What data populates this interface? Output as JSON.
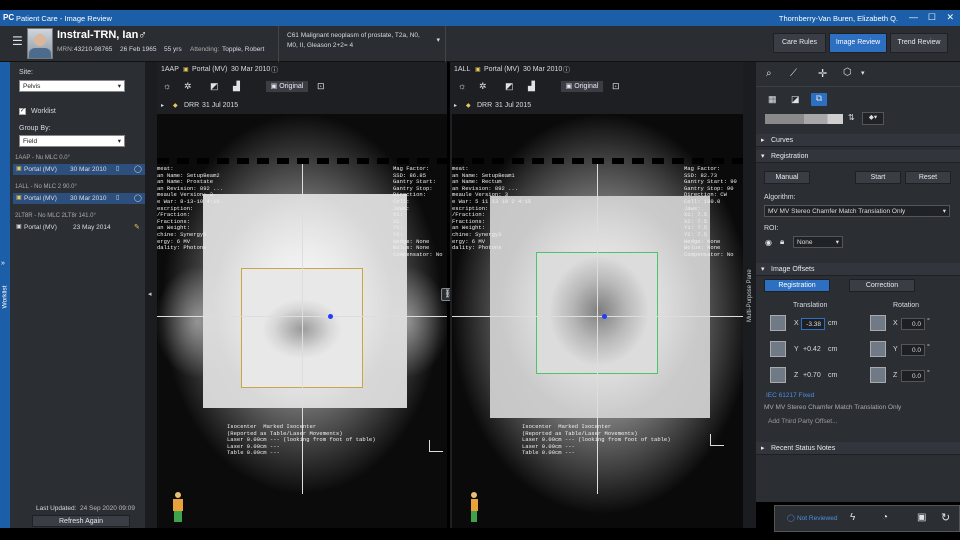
{
  "titlebar": {
    "logo": "PC",
    "title": "Patient Care - Image Review",
    "user": "Thornberry-Van Buren, Elizabeth Q.",
    "min": "—",
    "max": "☐",
    "close": "✕"
  },
  "patient": {
    "name": "Instral-TRN, Ian",
    "sex_symbol": "♂",
    "mrn_label": "MRN:",
    "mrn": "43210-98765",
    "dob": "26 Feb 1965",
    "age": "55 yrs",
    "attending_label": "Attending:",
    "attending": "Topple, Robert",
    "diagnosis_line1": "C61 Malignant neoplasm of prostate, T2a, N0,",
    "diagnosis_line2": "M0, II, Gleason 2+2= 4"
  },
  "nav_tabs": [
    "Care Rules",
    "Image Review",
    "Trend Review"
  ],
  "left": {
    "site_label": "Site:",
    "site_value": "Pelvis",
    "worklist_label": "Worklist",
    "groupby_label": "Group By:",
    "groupby_value": "Field",
    "groups": [
      {
        "header": "1AAP - Nu MLC 0.0°",
        "items": [
          {
            "label": "Portal (MV)",
            "date": "30 Mar 2010",
            "selected": true
          }
        ]
      },
      {
        "header": "1ALL - No MLC 2 90.0°",
        "items": [
          {
            "label": "Portal (MV)",
            "date": "30 Mar 2010",
            "selected": true
          }
        ]
      },
      {
        "header": "2LT8R - No MLC 2LT8r 141.0°",
        "items": [
          {
            "label": "Portal (MV)",
            "date": "23 May 2014",
            "selected": false
          }
        ]
      }
    ],
    "last_updated_label": "Last Updated:",
    "last_updated": "24 Sep 2020 09:09",
    "refresh": "Refresh Again",
    "side_tab": "Worklist"
  },
  "viewers": [
    {
      "field": "1AAP",
      "image": "Portal (MV)",
      "date": "30 Mar 2010",
      "original": "Original",
      "drr": "DRR",
      "drr_date": "31 Jul 2015",
      "text_left": "meat:\nan Name: SetupBeam2\nan Name: Prostate\nan Revision: 892 ...\nmeaule Version: 3\ne War: 8-13-10 4:15\nescription:\n/Fraction:\nFractions:\nan Weight:\nchine: SynergyS\nergy: 6 MV\ndality: Photons",
      "text_right": "Mag Factor:\nSSD: 86.85\nGantry Start:\nGantry Stop:\nDirection:\nColl:\nJaws:\nX1:\nX2:\nY1:\nY2:\nWedge: None\nBolus: None\nCompensator: No",
      "text_bottom": "Isocenter  Marked Isocenter\n(Reported as Table/Laser Movements)\nLaser 0.00cm --- (looking from foot of table)\nLaser 0.00cm ---\nTable 0.00cm ---"
    },
    {
      "field": "1ALL",
      "image": "Portal (MV)",
      "date": "30 Mar 2010",
      "original": "Original",
      "drr": "DRR",
      "drr_date": "31 Jul 2015",
      "text_left": "meat:\nan Name: SetupBeam1\nan Name: Rectum\nan Revision: 892 ...\nmeaule Version: 3\ne War: 5 11 13 10 2 4:15\nescription:\n/Fraction:\nFractions:\nan Weight:\nchine: SynergyS\nergy: 6 MV\ndality: Photons",
      "text_right": "Mag Factor:\nSSD: 82.73\nGantry Start: 90\nGantry Stop: 90\nDirection: CW\nColl: 180.0\nJaws:\nX1: 7.5\nX2: 7.5\nY1: 7.5\nY2: 7.5\nWedge: None\nBolus: None\nCompensator: No",
      "text_bottom": "Isocenter  Marked Isocenter\n(Reported as Table/Laser Movements)\nLaser 0.00cm --- (looking from foot of table)\nLaser 0.00cm ---\nTable 0.00cm ---"
    }
  ],
  "mpp_label": "Multi-Purpose Pane",
  "right": {
    "curves": "Curves",
    "registration": "Registration",
    "manual": "Manual",
    "start": "Start",
    "reset": "Reset",
    "algorithm_label": "Algorithm:",
    "algorithm": "MV MV Stereo Chamfer Match Translation Only",
    "roi_label": "ROI:",
    "roi_value": "None",
    "image_offsets": "Image Offsets",
    "tab_registration": "Registration",
    "tab_correction": "Correction",
    "translation": "Translation",
    "rotation": "Rotation",
    "rows": [
      {
        "axis": "X",
        "t": "-3.38",
        "unit": "cm",
        "r": "0.0",
        "runit": "°"
      },
      {
        "axis": "Y",
        "t": "+0.42",
        "unit": "cm",
        "r": "0.0",
        "runit": "°"
      },
      {
        "axis": "Z",
        "t": "+0.70",
        "unit": "cm",
        "r": "0.0",
        "runit": "°"
      }
    ],
    "iec": "IEC 61217 Fixed",
    "method": "MV MV Stereo Chamfer Match Translation Only",
    "third_party": "Add Third Party Offset...",
    "recent": "Recent Status Notes",
    "not_reviewed": "Not Reviewed"
  },
  "colors": {
    "accent": "#2d6fc0",
    "titlebar": "#1c5ea8",
    "roi_left": "#c9a544",
    "roi_right": "#4cc46c",
    "isocenter": "#1f3cff"
  }
}
